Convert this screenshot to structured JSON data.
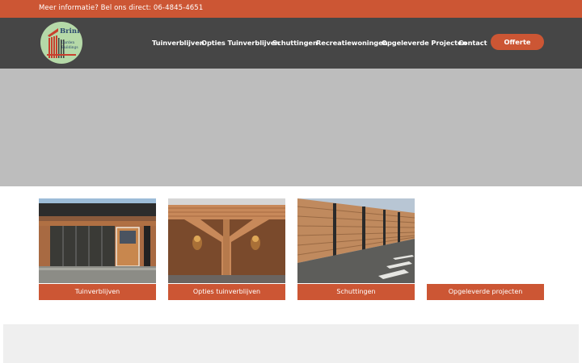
{
  "topbar": {
    "info_text": "Meer informatie? Bel ons direct: 06-4845-4651"
  },
  "logo": {
    "brand": "Brink",
    "line1": "Garden",
    "line2": "Buildings"
  },
  "nav": {
    "items": [
      {
        "label": "Tuinverblijven"
      },
      {
        "label": "Opties Tuinverblijven"
      },
      {
        "label": "Schuttingen"
      },
      {
        "label": "Recreatiewoningen"
      },
      {
        "label": "Opgeleverde Projecten"
      },
      {
        "label": "Contact"
      }
    ],
    "cta_label": "Offerte"
  },
  "cards": [
    {
      "label": "Tuinverblijven"
    },
    {
      "label": "Opties tuinverblijven"
    },
    {
      "label": "Schuttingen"
    },
    {
      "label": "Opgeleverde projecten"
    }
  ],
  "colors": {
    "accent": "#cc5634",
    "header": "#464646",
    "hero": "#bdbdbd"
  }
}
